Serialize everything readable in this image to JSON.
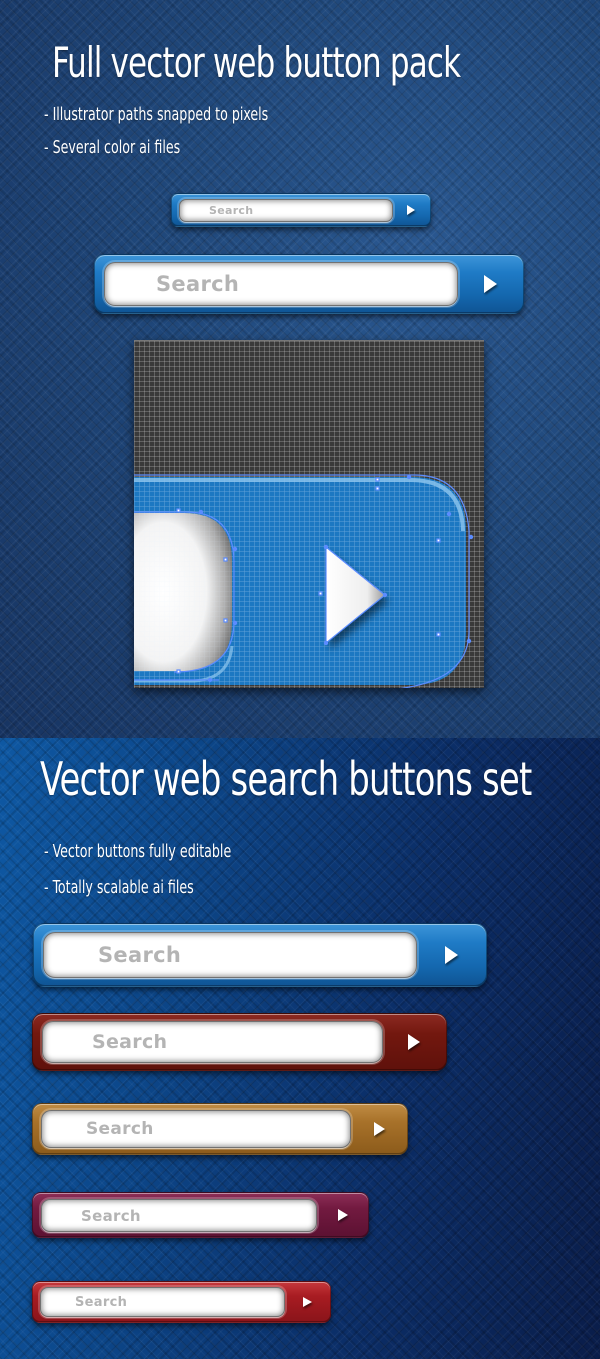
{
  "top_section": {
    "title": "Full vector web button pack",
    "bullets": [
      "- Illustrator paths snapped to pixels",
      "- Several color ai files"
    ],
    "search_bars": [
      {
        "placeholder": "Search",
        "color": "blue"
      },
      {
        "placeholder": "Search",
        "color": "blue"
      }
    ],
    "zoom_preview": {
      "description": "Illustrator pixel-grid close-up of search bar corner with arrow",
      "grid_background": "#3a3a3a",
      "button_color": "#1e78c2",
      "path_color": "#5b8cff"
    }
  },
  "bottom_section": {
    "title": "Vector web search buttons set",
    "bullets": [
      "- Vector buttons fully editable",
      "- Totally scalable ai files"
    ],
    "search_bars": [
      {
        "placeholder": "Search",
        "color": "blue",
        "hex": "#1a72bd"
      },
      {
        "placeholder": "Search",
        "color": "maroon",
        "hex": "#6b150e"
      },
      {
        "placeholder": "Search",
        "color": "gold",
        "hex": "#a06b25"
      },
      {
        "placeholder": "Search",
        "color": "purple",
        "hex": "#6c173c"
      },
      {
        "placeholder": "Search",
        "color": "red",
        "hex": "#a01a20"
      }
    ]
  },
  "icons": {
    "submit": "play-arrow-icon"
  }
}
